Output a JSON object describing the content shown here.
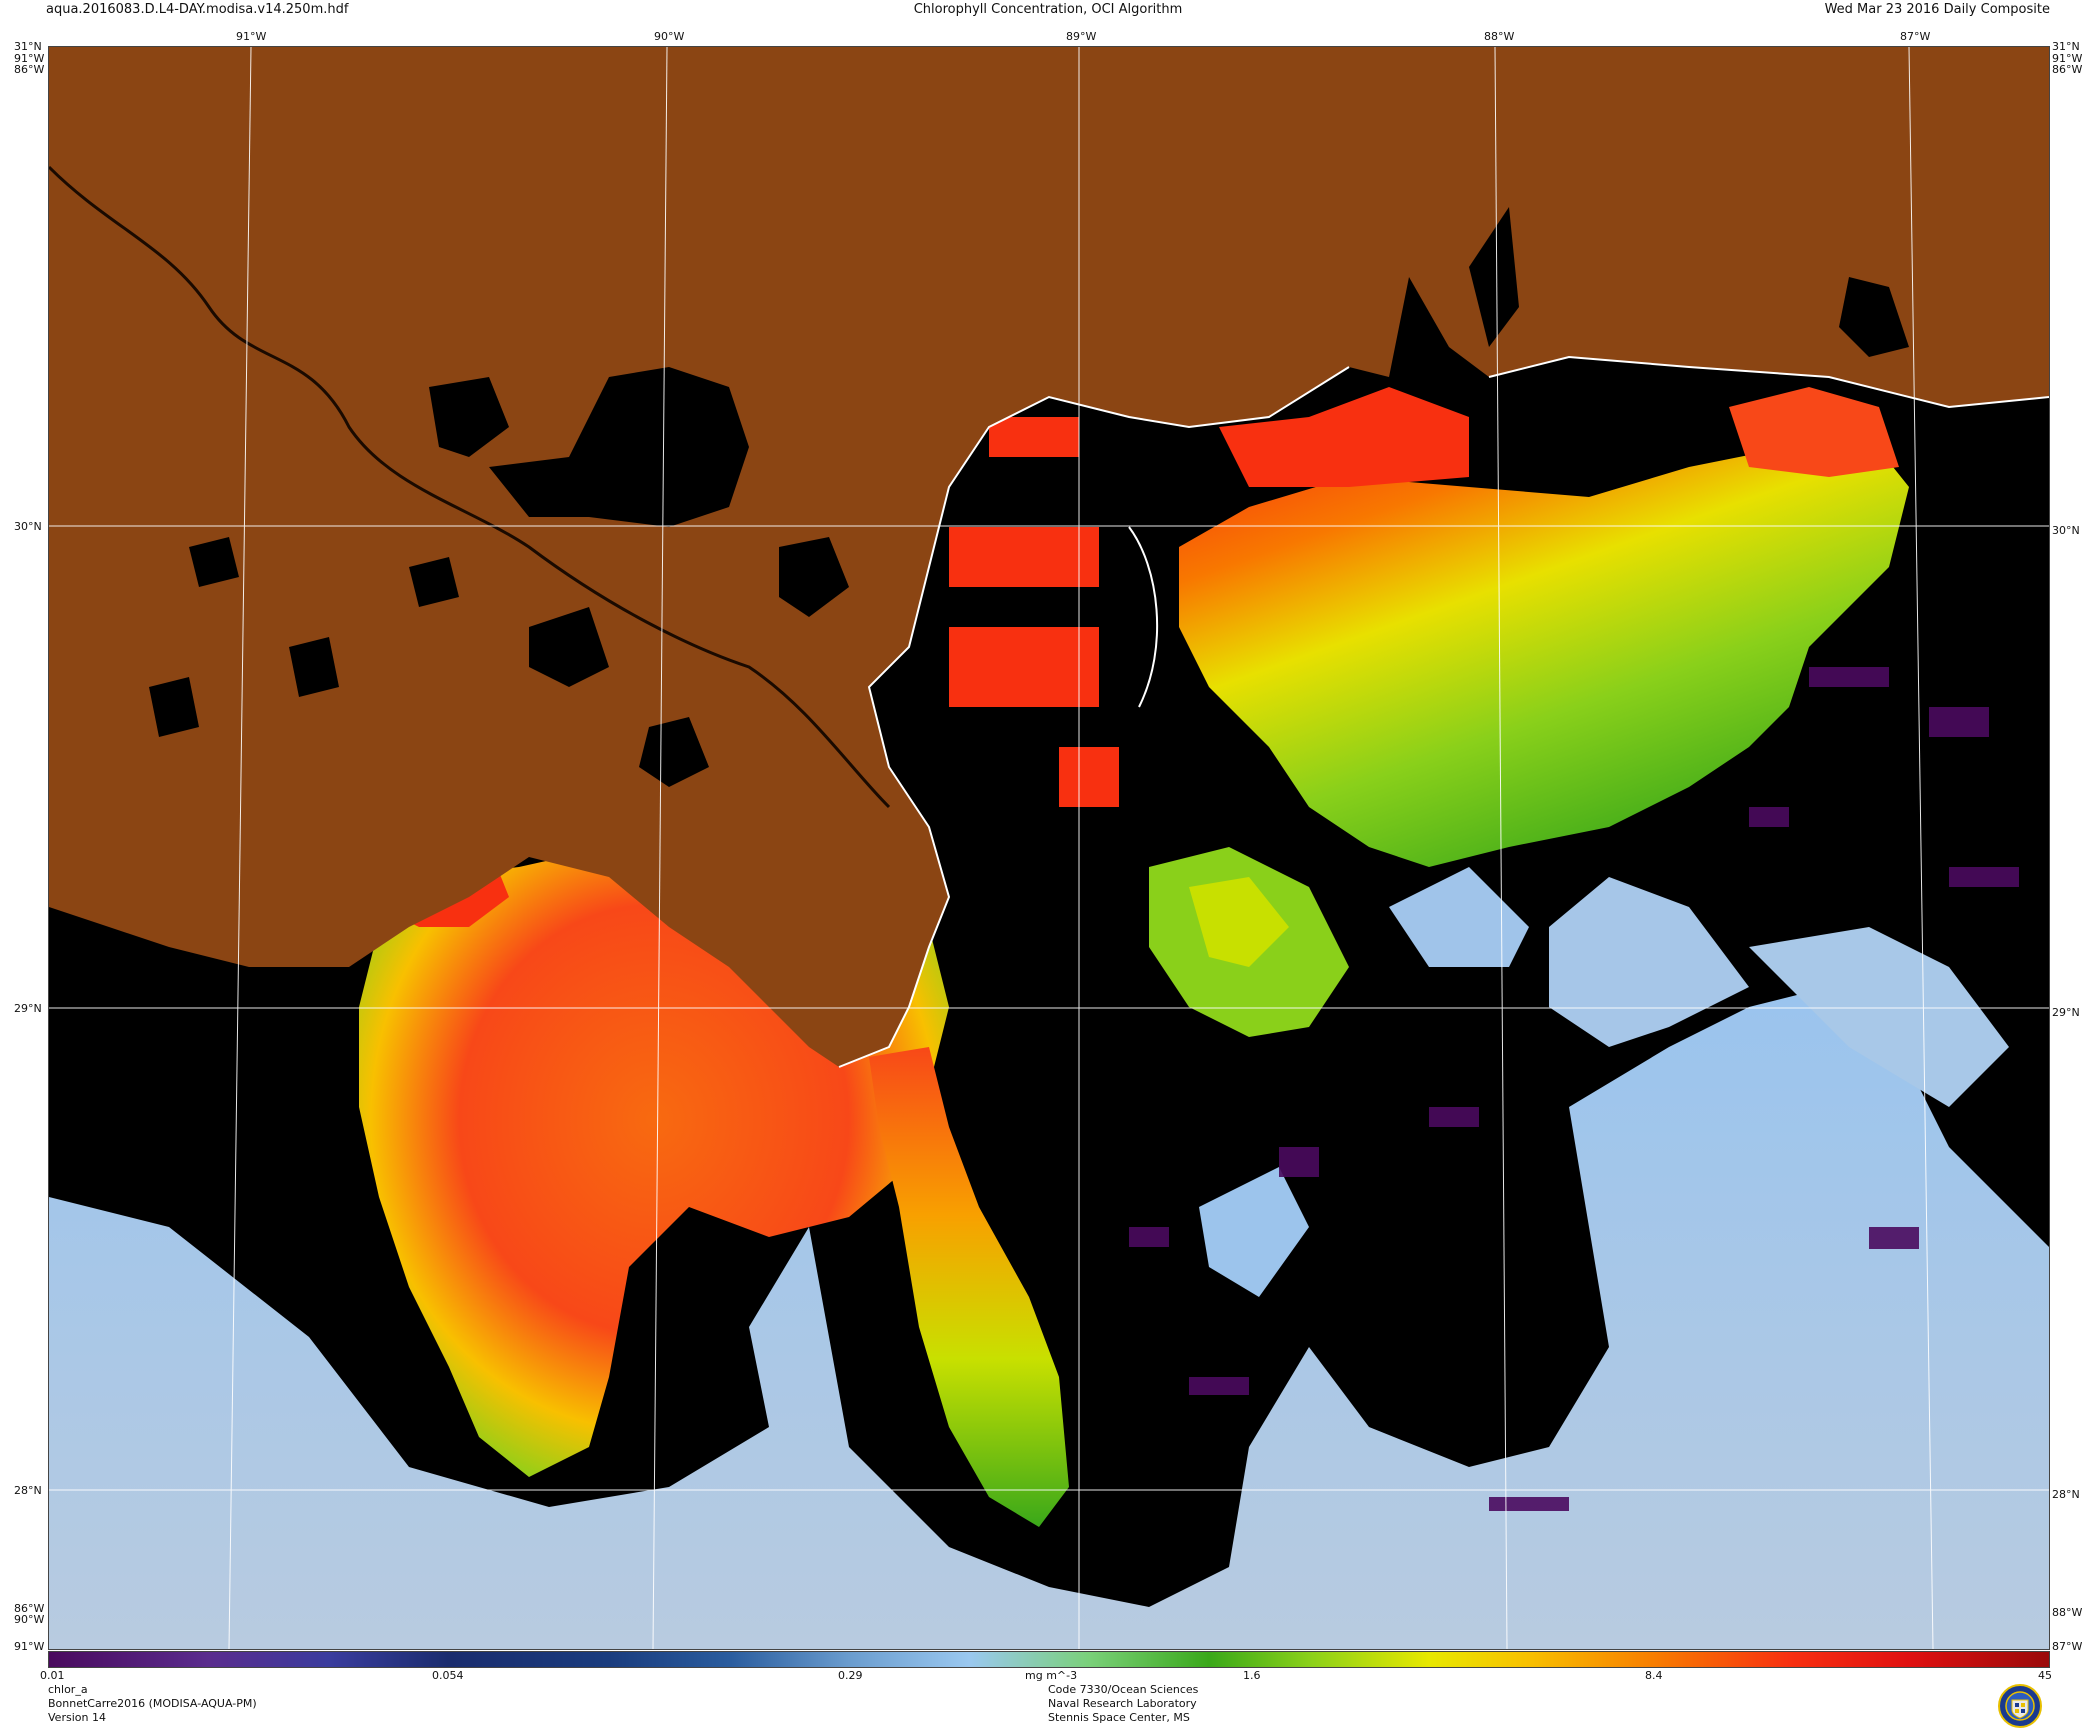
{
  "header": {
    "file_name": "aqua.2016083.D.L4-DAY.modisa.v14.250m.hdf",
    "title": "Chlorophyll Concentration, OCI Algorithm",
    "composite_date": "Wed Mar 23 2016 Daily Composite"
  },
  "map": {
    "longitude_labels_top": [
      "91°W",
      "90°W",
      "89°W",
      "88°W",
      "87°W"
    ],
    "latitude_labels": [
      "31°N",
      "30°N",
      "29°N",
      "28°N"
    ],
    "corner_labels": {
      "top_left_lat": "31°N",
      "top_left_lon": "91°W",
      "top_left_lon_under": "86°W",
      "top_right_lat": "31°N",
      "top_right_lon": "91°W",
      "top_right_lon_under": "86°W",
      "bottom_left_lon": "86°W",
      "bottom_left_lon2": "90°W",
      "bottom_left_lon3": "91°W",
      "bottom_right_lon": "88°W",
      "bottom_right_lon2": "87°W"
    },
    "colors": {
      "land": "#8B4513",
      "no_data": "#000000",
      "coastline": "#ffffff",
      "grid": "#ffffff"
    }
  },
  "colorbar": {
    "ticks": [
      "0.01",
      "0.054",
      "0.29",
      "mg m^-3",
      "1.6",
      "8.4",
      "45"
    ],
    "min": 0.01,
    "max": 45,
    "scale": "log"
  },
  "footer": {
    "variable": "chlor_a",
    "event": "BonnetCarre2016 (MODISA-AQUA-PM)",
    "version": "Version 14",
    "org_line1": "Code 7330/Ocean Sciences",
    "org_line2": "Naval Research Laboratory",
    "org_line3": "Stennis Space Center, MS"
  }
}
